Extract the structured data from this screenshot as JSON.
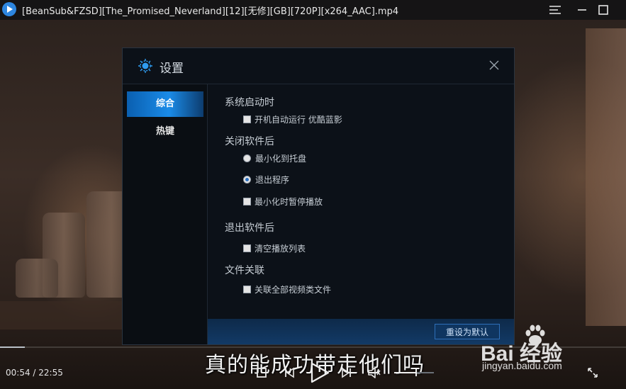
{
  "window": {
    "title": "[BeanSub&FZSD][The_Promised_Neverland][12][无修][GB][720P][x264_AAC].mp4",
    "controls": [
      "menu-icon",
      "minimize-icon",
      "maximize-icon"
    ]
  },
  "dialog": {
    "title": "设置",
    "nav": [
      {
        "label": "综合",
        "active": true
      },
      {
        "label": "热键",
        "active": false
      }
    ],
    "sections": {
      "startup": {
        "heading": "系统启动时",
        "options": [
          {
            "label": "开机自动运行 优酷蓝影",
            "type": "checkbox",
            "checked": false
          }
        ]
      },
      "close": {
        "heading": "关闭软件后",
        "options": [
          {
            "label": "最小化到托盘",
            "type": "radio",
            "checked": false
          },
          {
            "label": "退出程序",
            "type": "radio",
            "checked": true
          },
          {
            "label": "最小化时暂停播放",
            "type": "checkbox",
            "checked": false
          }
        ]
      },
      "exit": {
        "heading": "退出软件后",
        "options": [
          {
            "label": "清空播放列表",
            "type": "checkbox",
            "checked": false
          }
        ]
      },
      "assoc": {
        "heading": "文件关联",
        "options": [
          {
            "label": "关联全部视频类文件",
            "type": "checkbox",
            "checked": false
          }
        ]
      }
    },
    "reset_button": "重设为默认"
  },
  "player": {
    "subtitle": "真的能成功带走他们吗",
    "current_time": "00:54",
    "total_time": "22:55",
    "time_display": "00:54 / 22:55",
    "progress_fraction": 0.04,
    "volume_fraction": 0.55
  },
  "watermark": {
    "brand": "Bai  经验",
    "url": "jingyan.baidu.com"
  },
  "colors": {
    "accent": "#1a8be8",
    "dialog_bg": "#0c1118",
    "footer": "#123a66"
  }
}
